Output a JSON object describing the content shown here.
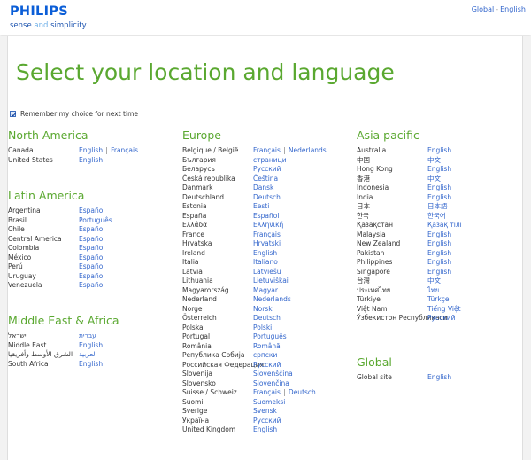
{
  "header": {
    "logo": "PHILIPS",
    "tagline_part1": "sense",
    "tagline_and": "and",
    "tagline_part2": "simplicity",
    "top_link_global": "Global",
    "top_link_sep": "-",
    "top_link_lang": "English"
  },
  "page": {
    "title": "Select your location and language",
    "remember_label": "Remember my choice for next time",
    "remember_checked": true
  },
  "colors": {
    "heading_green": "#5aa830",
    "link_blue": "#3366cc",
    "brand_blue": "#0b5ed7"
  },
  "regions": {
    "north_america": {
      "title": "North America",
      "rows": [
        {
          "country": "Canada",
          "langs": [
            "English",
            "Français"
          ]
        },
        {
          "country": "United States",
          "langs": [
            "English"
          ]
        }
      ]
    },
    "latin_america": {
      "title": "Latin America",
      "rows": [
        {
          "country": "Argentina",
          "langs": [
            "Español"
          ]
        },
        {
          "country": "Brasil",
          "langs": [
            "Português"
          ]
        },
        {
          "country": "Chile",
          "langs": [
            "Español"
          ]
        },
        {
          "country": "Central America",
          "langs": [
            "Español"
          ]
        },
        {
          "country": "Colombia",
          "langs": [
            "Español"
          ]
        },
        {
          "country": "México",
          "langs": [
            "Español"
          ]
        },
        {
          "country": "Perú",
          "langs": [
            "Español"
          ]
        },
        {
          "country": "Uruguay",
          "langs": [
            "Español"
          ]
        },
        {
          "country": "Venezuela",
          "langs": [
            "Español"
          ]
        }
      ]
    },
    "middle_east_africa": {
      "title": "Middle East & Africa",
      "rows": [
        {
          "country": "ישראל",
          "langs": [
            "עברית"
          ]
        },
        {
          "country": "Middle East",
          "langs": [
            "English"
          ]
        },
        {
          "country": "الشرق الأوسط وأفريقيا",
          "langs": [
            "العربية"
          ]
        },
        {
          "country": "South Africa",
          "langs": [
            "English"
          ]
        }
      ]
    },
    "europe": {
      "title": "Europe",
      "rows": [
        {
          "country": "Belgique / België",
          "langs": [
            "Français",
            "Nederlands"
          ]
        },
        {
          "country": "България",
          "langs": [
            "страници"
          ]
        },
        {
          "country": "Беларусь",
          "langs": [
            "Русский"
          ]
        },
        {
          "country": "Česká republika",
          "langs": [
            "Čeština"
          ]
        },
        {
          "country": "Danmark",
          "langs": [
            "Dansk"
          ]
        },
        {
          "country": "Deutschland",
          "langs": [
            "Deutsch"
          ]
        },
        {
          "country": "Estonia",
          "langs": [
            "Eesti"
          ]
        },
        {
          "country": "España",
          "langs": [
            "Español"
          ]
        },
        {
          "country": "Ελλάδα",
          "langs": [
            "Ελληνική"
          ]
        },
        {
          "country": "France",
          "langs": [
            "Français"
          ]
        },
        {
          "country": "Hrvatska",
          "langs": [
            "Hrvatski"
          ]
        },
        {
          "country": "Ireland",
          "langs": [
            "English"
          ]
        },
        {
          "country": "Italia",
          "langs": [
            "Italiano"
          ]
        },
        {
          "country": "Latvia",
          "langs": [
            "Latviešu"
          ]
        },
        {
          "country": "Lithuania",
          "langs": [
            "Lietuviškai"
          ]
        },
        {
          "country": "Magyarország",
          "langs": [
            "Magyar"
          ]
        },
        {
          "country": "Nederland",
          "langs": [
            "Nederlands"
          ]
        },
        {
          "country": "Norge",
          "langs": [
            "Norsk"
          ]
        },
        {
          "country": "Österreich",
          "langs": [
            "Deutsch"
          ]
        },
        {
          "country": "Polska",
          "langs": [
            "Polski"
          ]
        },
        {
          "country": "Portugal",
          "langs": [
            "Português"
          ]
        },
        {
          "country": "România",
          "langs": [
            "Română"
          ]
        },
        {
          "country": "Република Србија",
          "langs": [
            "српски"
          ]
        },
        {
          "country": "Российская Федерация",
          "langs": [
            "Русский"
          ]
        },
        {
          "country": "Slovenija",
          "langs": [
            "Slovenščina"
          ]
        },
        {
          "country": "Slovensko",
          "langs": [
            "Slovenčina"
          ]
        },
        {
          "country": "Suisse / Schweiz",
          "langs": [
            "Français",
            "Deutsch"
          ]
        },
        {
          "country": "Suomi",
          "langs": [
            "Suomeksi"
          ]
        },
        {
          "country": "Sverige",
          "langs": [
            "Svensk"
          ]
        },
        {
          "country": "Україна",
          "langs": [
            "Русский"
          ]
        },
        {
          "country": "United Kingdom",
          "langs": [
            "English"
          ]
        }
      ]
    },
    "asia_pacific": {
      "title": "Asia pacific",
      "rows": [
        {
          "country": "Australia",
          "langs": [
            "English"
          ]
        },
        {
          "country": "中国",
          "langs": [
            "中文"
          ]
        },
        {
          "country": "Hong Kong",
          "langs": [
            "English"
          ]
        },
        {
          "country": "香港",
          "langs": [
            "中文"
          ]
        },
        {
          "country": "Indonesia",
          "langs": [
            "English"
          ]
        },
        {
          "country": "India",
          "langs": [
            "English"
          ]
        },
        {
          "country": "日本",
          "langs": [
            "日本語"
          ]
        },
        {
          "country": "한국",
          "langs": [
            "한국어"
          ]
        },
        {
          "country": "Қазақстан",
          "langs": [
            "Қазақ тілі"
          ]
        },
        {
          "country": "Malaysia",
          "langs": [
            "English"
          ]
        },
        {
          "country": "New Zealand",
          "langs": [
            "English"
          ]
        },
        {
          "country": "Pakistan",
          "langs": [
            "English"
          ]
        },
        {
          "country": "Philippines",
          "langs": [
            "English"
          ]
        },
        {
          "country": "Singapore",
          "langs": [
            "English"
          ]
        },
        {
          "country": "台灣",
          "langs": [
            "中文"
          ]
        },
        {
          "country": "ประเทศไทย",
          "langs": [
            "ไทย"
          ]
        },
        {
          "country": "Türkiye",
          "langs": [
            "Türkçe"
          ]
        },
        {
          "country": "Việt Nam",
          "langs": [
            "Tiếng Việt"
          ]
        },
        {
          "country": "Ўзбекистон Республикаси",
          "langs": [
            "Русский"
          ]
        }
      ]
    },
    "global": {
      "title": "Global",
      "rows": [
        {
          "country": "Global site",
          "langs": [
            "English"
          ]
        }
      ]
    }
  }
}
